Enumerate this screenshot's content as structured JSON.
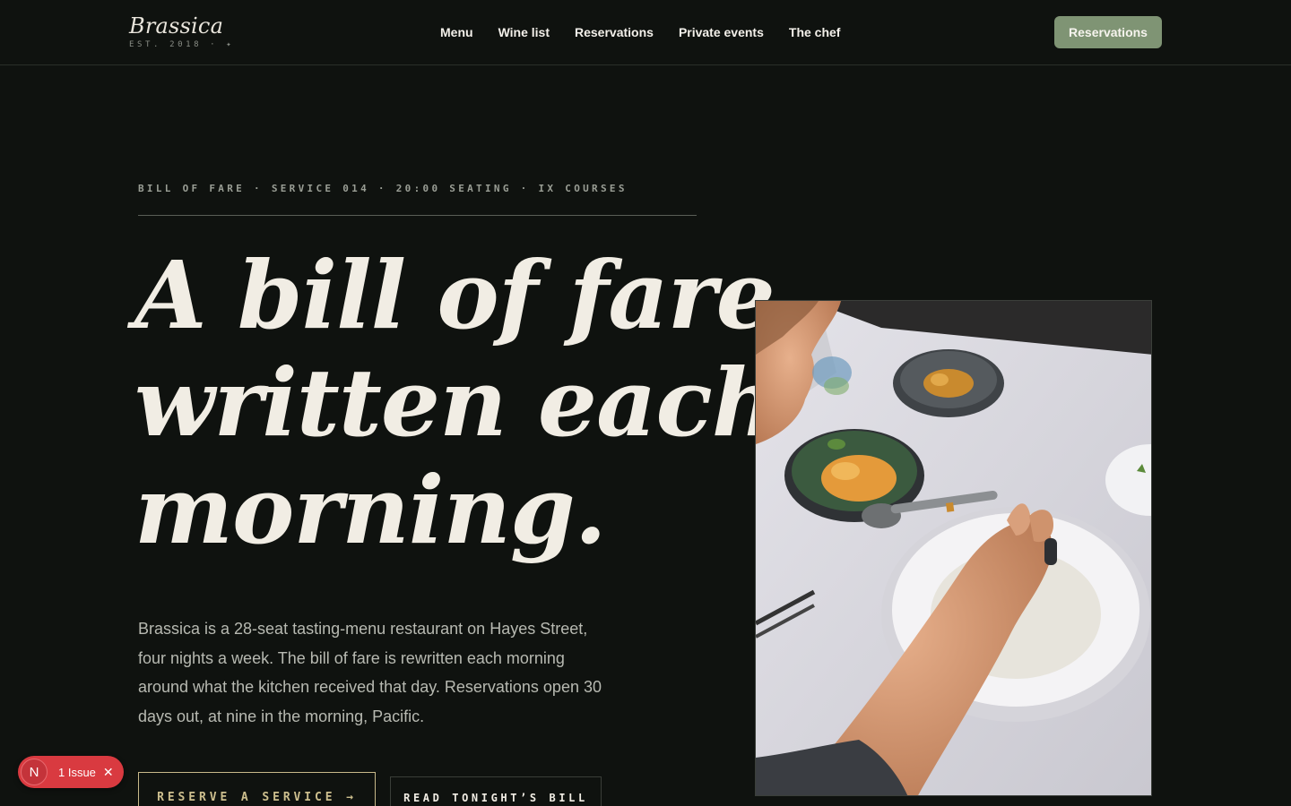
{
  "brand": {
    "name": "Brassica",
    "tagline": "EST. 2018 · ✦"
  },
  "nav": {
    "items": [
      {
        "label": "Menu"
      },
      {
        "label": "Wine list"
      },
      {
        "label": "Reservations"
      },
      {
        "label": "Private events"
      },
      {
        "label": "The chef"
      }
    ],
    "cta_label": "Reservations"
  },
  "hero": {
    "kicker": "BILL OF FARE · SERVICE 014 · 20:00 SEATING · IX COURSES",
    "headline_lines": [
      "A bill of fare,",
      "written each",
      "morning."
    ],
    "lede": "Brassica is a 28-seat tasting-menu restaurant on Hayes Street, four nights a week. The bill of fare is rewritten each morning around what the kitchen received that day. Reservations open 30 days out, at nine in the morning, Pacific.",
    "primary_button": "RESERVE A SERVICE →",
    "secondary_button": "READ TONIGHT’S BILL"
  },
  "dev_badge": {
    "logo": "N",
    "label": "1 Issue",
    "close": "✕"
  },
  "colors": {
    "background": "#0f120f",
    "accent_green": "#7f9474",
    "accent_gold": "#cdbf8e",
    "text": "#f1ede4",
    "badge_red": "#d93a40"
  }
}
